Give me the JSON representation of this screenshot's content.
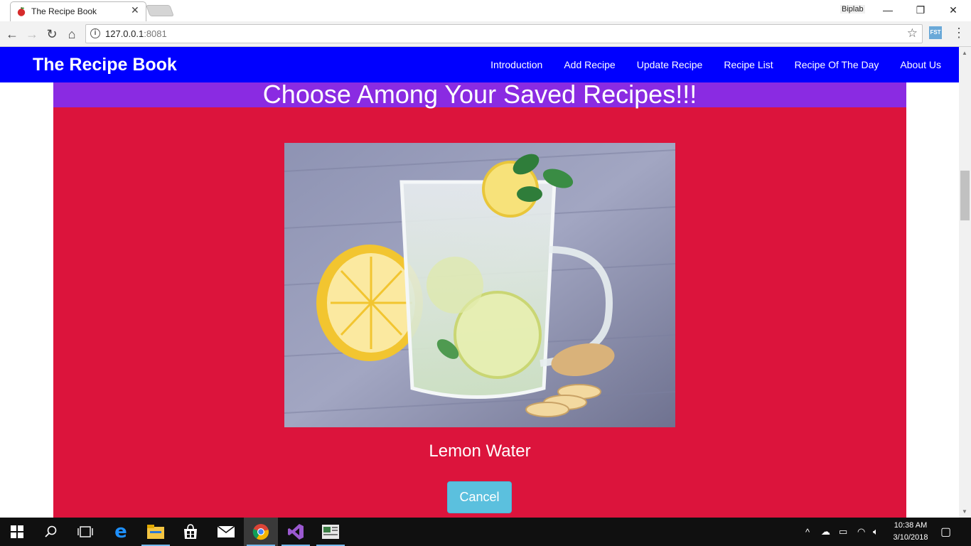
{
  "browser": {
    "tab_title": "The Recipe Book",
    "tab_close": "✕",
    "profile_name": "Biplab",
    "url_host": "127.0.0.1",
    "url_port": ":8081",
    "ext_label": "FST"
  },
  "navbar": {
    "brand": "The Recipe Book",
    "links": [
      "Introduction",
      "Add Recipe",
      "Update Recipe",
      "Recipe List",
      "Recipe Of The Day",
      "About Us"
    ],
    "color": "#0000ff"
  },
  "main": {
    "heading": "Choose Among Your Saved Recipes!!!",
    "recipe_name": "Lemon Water",
    "cancel_label": "Cancel",
    "band_color": "#8a2be2",
    "panel_color": "#dc143c",
    "button_color": "#5bc0de"
  },
  "taskbar": {
    "time": "10:38 AM",
    "date": "3/10/2018",
    "apps": [
      "start-icon",
      "search-icon",
      "task-view-icon",
      "edge-icon",
      "file-explorer-icon",
      "store-icon",
      "mail-icon",
      "chrome-icon",
      "visual-studio-icon",
      "app-icon"
    ]
  }
}
